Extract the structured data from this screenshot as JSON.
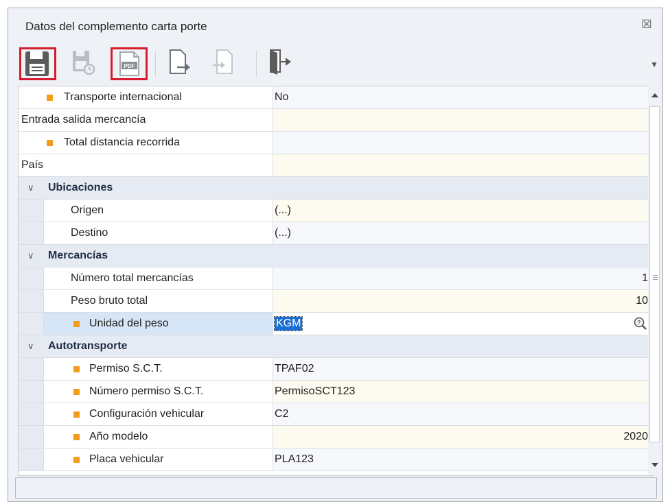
{
  "window": {
    "title": "Datos del complemento carta porte",
    "close_glyph": "☒"
  },
  "toolbar": {
    "buttons": [
      {
        "name": "save-icon",
        "label": "Guardar",
        "highlighted": true,
        "enabled": true
      },
      {
        "name": "save-close-icon",
        "label": "Guardar y cerrar",
        "highlighted": false,
        "enabled": false
      },
      {
        "name": "pdf-icon",
        "label": "PDF",
        "highlighted": true,
        "enabled": true
      },
      {
        "name": "export-icon",
        "label": "Exportar",
        "highlighted": false,
        "enabled": true
      },
      {
        "name": "import-icon",
        "label": "Importar",
        "highlighted": false,
        "enabled": false
      },
      {
        "name": "exit-icon",
        "label": "Salir",
        "highlighted": false,
        "enabled": true
      }
    ],
    "pdf_text": "PDF",
    "more_glyph": "▼"
  },
  "grid": {
    "rows": [
      {
        "label": "Transporte internacional",
        "value": "No"
      },
      {
        "label": "Entrada salida mercancía",
        "value": ""
      },
      {
        "label": "Total distancia recorrida",
        "value": ""
      },
      {
        "label": "País",
        "value": ""
      },
      {
        "label": "Ubicaciones"
      },
      {
        "label": "Origen",
        "value": "(...)"
      },
      {
        "label": "Destino",
        "value": "(...)"
      },
      {
        "label": "Mercancías"
      },
      {
        "label": "Número total mercancías",
        "value": "1"
      },
      {
        "label": "Peso bruto total",
        "value": "10"
      },
      {
        "label": "Unidad del peso",
        "value": "KGM"
      },
      {
        "label": "Autotransporte"
      },
      {
        "label": "Permiso S.C.T.",
        "value": "TPAF02"
      },
      {
        "label": "Número permiso S.C.T.",
        "value": "PermisoSCT123"
      },
      {
        "label": "Configuración vehicular",
        "value": "C2"
      },
      {
        "label": "Año modelo",
        "value": "2020"
      },
      {
        "label": "Placa vehicular",
        "value": "PLA123"
      }
    ]
  },
  "colors": {
    "required_bullet": "#f39c1b",
    "highlight_border": "#d61c2c",
    "selection": "#1b6fd3"
  }
}
